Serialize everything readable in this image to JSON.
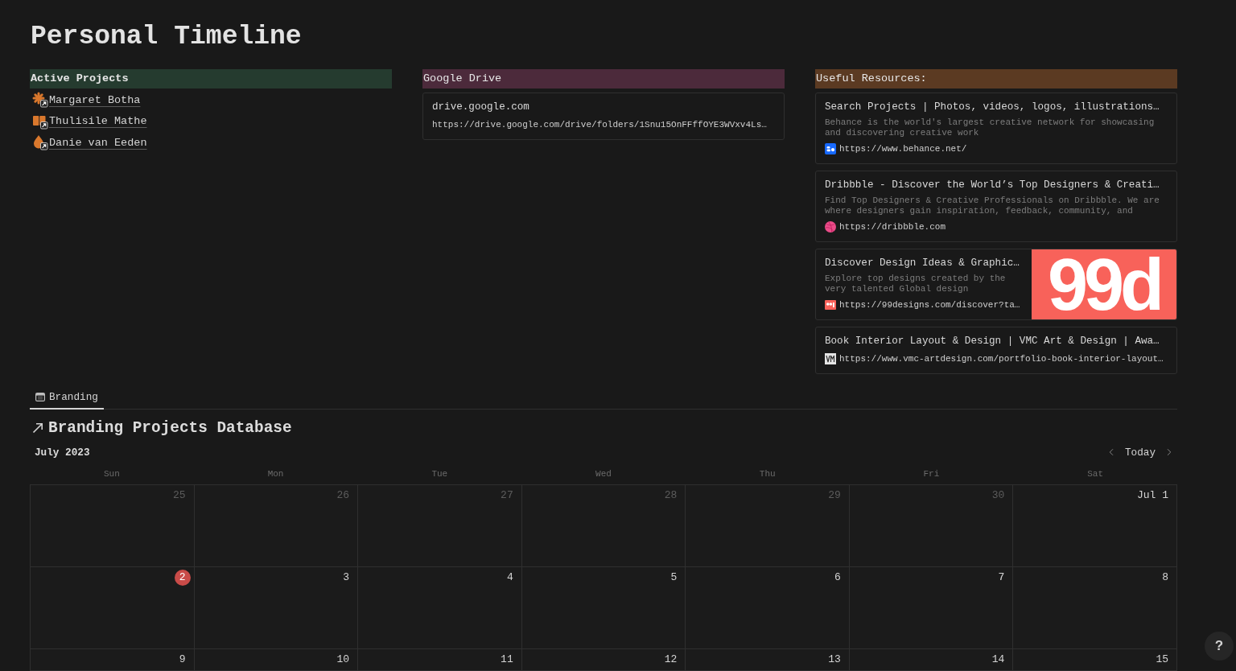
{
  "page": {
    "title": "Personal Timeline"
  },
  "sections": [
    {
      "kind": "pages",
      "heading": "Active Projects",
      "bold": true,
      "color": "#253b2f",
      "items": [
        {
          "label": "Margaret Botha"
        },
        {
          "label": "Thulisile Mathe"
        },
        {
          "label": "Danie van Eeden"
        }
      ]
    },
    {
      "kind": "bookmarks",
      "heading": "Google Drive",
      "bold": false,
      "color": "#4c2a3b",
      "bookmarks": [
        {
          "title": "drive.google.com",
          "url": "https://drive.google.com/drive/folders/1Snu15OnFFffOYE3WVxv4Ls…",
          "favicon": false
        }
      ]
    },
    {
      "kind": "bookmarks",
      "heading": "Useful Resources:",
      "bold": false,
      "color": "#5b3a22",
      "bookmarks": [
        {
          "title": "Search Projects | Photos, videos, logos, illustrations…",
          "description": "Behance is the world's largest creative network for showcasing and discovering creative work",
          "url": "https://www.behance.net/",
          "favicon": true
        },
        {
          "title": "Dribbble - Discover the World’s Top Designers & Creati…",
          "description": "Find Top Designers & Creative Professionals on Dribbble. We are where designers gain inspiration, feedback, community, and",
          "url": "https://dribbble.com",
          "favicon": true
        },
        {
          "title": "Discover Design Ideas & Graphic…",
          "description": "Explore top designs created by the very talented Global design",
          "url": "https://99designs.com/discover?ta…",
          "favicon": true,
          "preview_logo": "99d"
        },
        {
          "title": "Book Interior Layout & Design | VMC Art & Design | Awa…",
          "url": "https://www.vmc-artdesign.com/portfolio-book-interior-layout…",
          "favicon": true
        }
      ]
    }
  ],
  "view_tabs": [
    {
      "label": "Branding",
      "selected": true
    }
  ],
  "database": {
    "title": "Branding Projects Database",
    "month": "July 2023",
    "today_button": "Today",
    "weekdays": [
      "Sun",
      "Mon",
      "Tue",
      "Wed",
      "Thu",
      "Fri",
      "Sat"
    ],
    "weeks": [
      [
        {
          "label": "25",
          "in_month": false,
          "today": false
        },
        {
          "label": "26",
          "in_month": false,
          "today": false
        },
        {
          "label": "27",
          "in_month": false,
          "today": false
        },
        {
          "label": "28",
          "in_month": false,
          "today": false
        },
        {
          "label": "29",
          "in_month": false,
          "today": false
        },
        {
          "label": "30",
          "in_month": false,
          "today": false
        },
        {
          "label": "Jul 1",
          "in_month": true,
          "today": false
        }
      ],
      [
        {
          "label": "2",
          "in_month": true,
          "today": true
        },
        {
          "label": "3",
          "in_month": true,
          "today": false
        },
        {
          "label": "4",
          "in_month": true,
          "today": false
        },
        {
          "label": "5",
          "in_month": true,
          "today": false
        },
        {
          "label": "6",
          "in_month": true,
          "today": false
        },
        {
          "label": "7",
          "in_month": true,
          "today": false
        },
        {
          "label": "8",
          "in_month": true,
          "today": false
        }
      ],
      [
        {
          "label": "9",
          "in_month": true,
          "today": false
        },
        {
          "label": "10",
          "in_month": true,
          "today": false
        },
        {
          "label": "11",
          "in_month": true,
          "today": false
        },
        {
          "label": "12",
          "in_month": true,
          "today": false
        },
        {
          "label": "13",
          "in_month": true,
          "today": false
        },
        {
          "label": "14",
          "in_month": true,
          "today": false
        },
        {
          "label": "15",
          "in_month": true,
          "today": false
        }
      ]
    ]
  },
  "help_button": "?"
}
